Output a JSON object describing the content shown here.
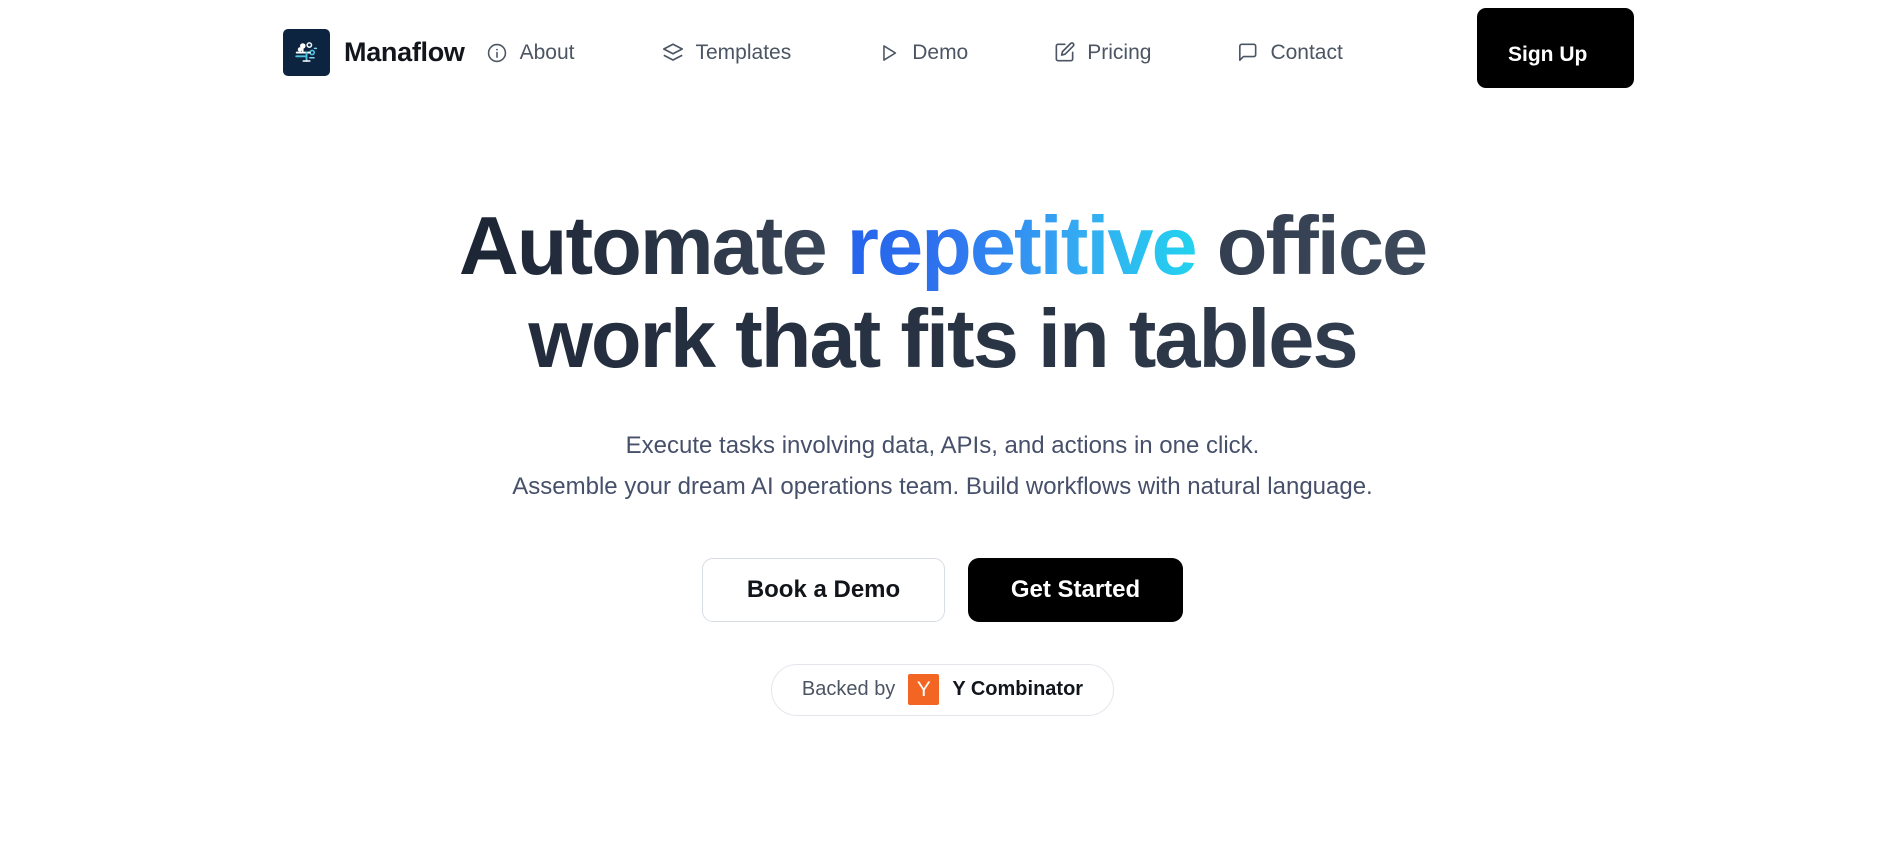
{
  "brand": {
    "name": "Manaflow",
    "logo_icon": "circuit-node-logo-icon",
    "logo_bg": "#0d2440"
  },
  "nav": {
    "items": [
      {
        "label": "About",
        "icon": "info-circle-icon"
      },
      {
        "label": "Templates",
        "icon": "layers-icon"
      },
      {
        "label": "Demo",
        "icon": "play-triangle-icon"
      },
      {
        "label": "Pricing",
        "icon": "square-pen-icon"
      },
      {
        "label": "Contact",
        "icon": "message-square-icon"
      }
    ],
    "signup_label": "Sign Up",
    "signup_bg": "#000000"
  },
  "hero": {
    "headline_line1_part1": "Automate ",
    "headline_line1_highlight": "repetitive",
    "headline_line1_part2": " office",
    "headline_line2": "work that fits in tables",
    "highlight_gradient_from": "#2563eb",
    "highlight_gradient_to": "#22d3ee",
    "headline_color": "#2c3647",
    "subhead_line1": "Execute tasks involving data, APIs, and actions in one click.",
    "subhead_line2": "Assemble your dream AI operations team. Build workflows with natural language.",
    "cta_secondary": "Book a Demo",
    "cta_primary": "Get Started"
  },
  "badge": {
    "prefix": "Backed by",
    "mark_letter": "Y",
    "mark_color": "#f26522",
    "name": "Y Combinator"
  }
}
